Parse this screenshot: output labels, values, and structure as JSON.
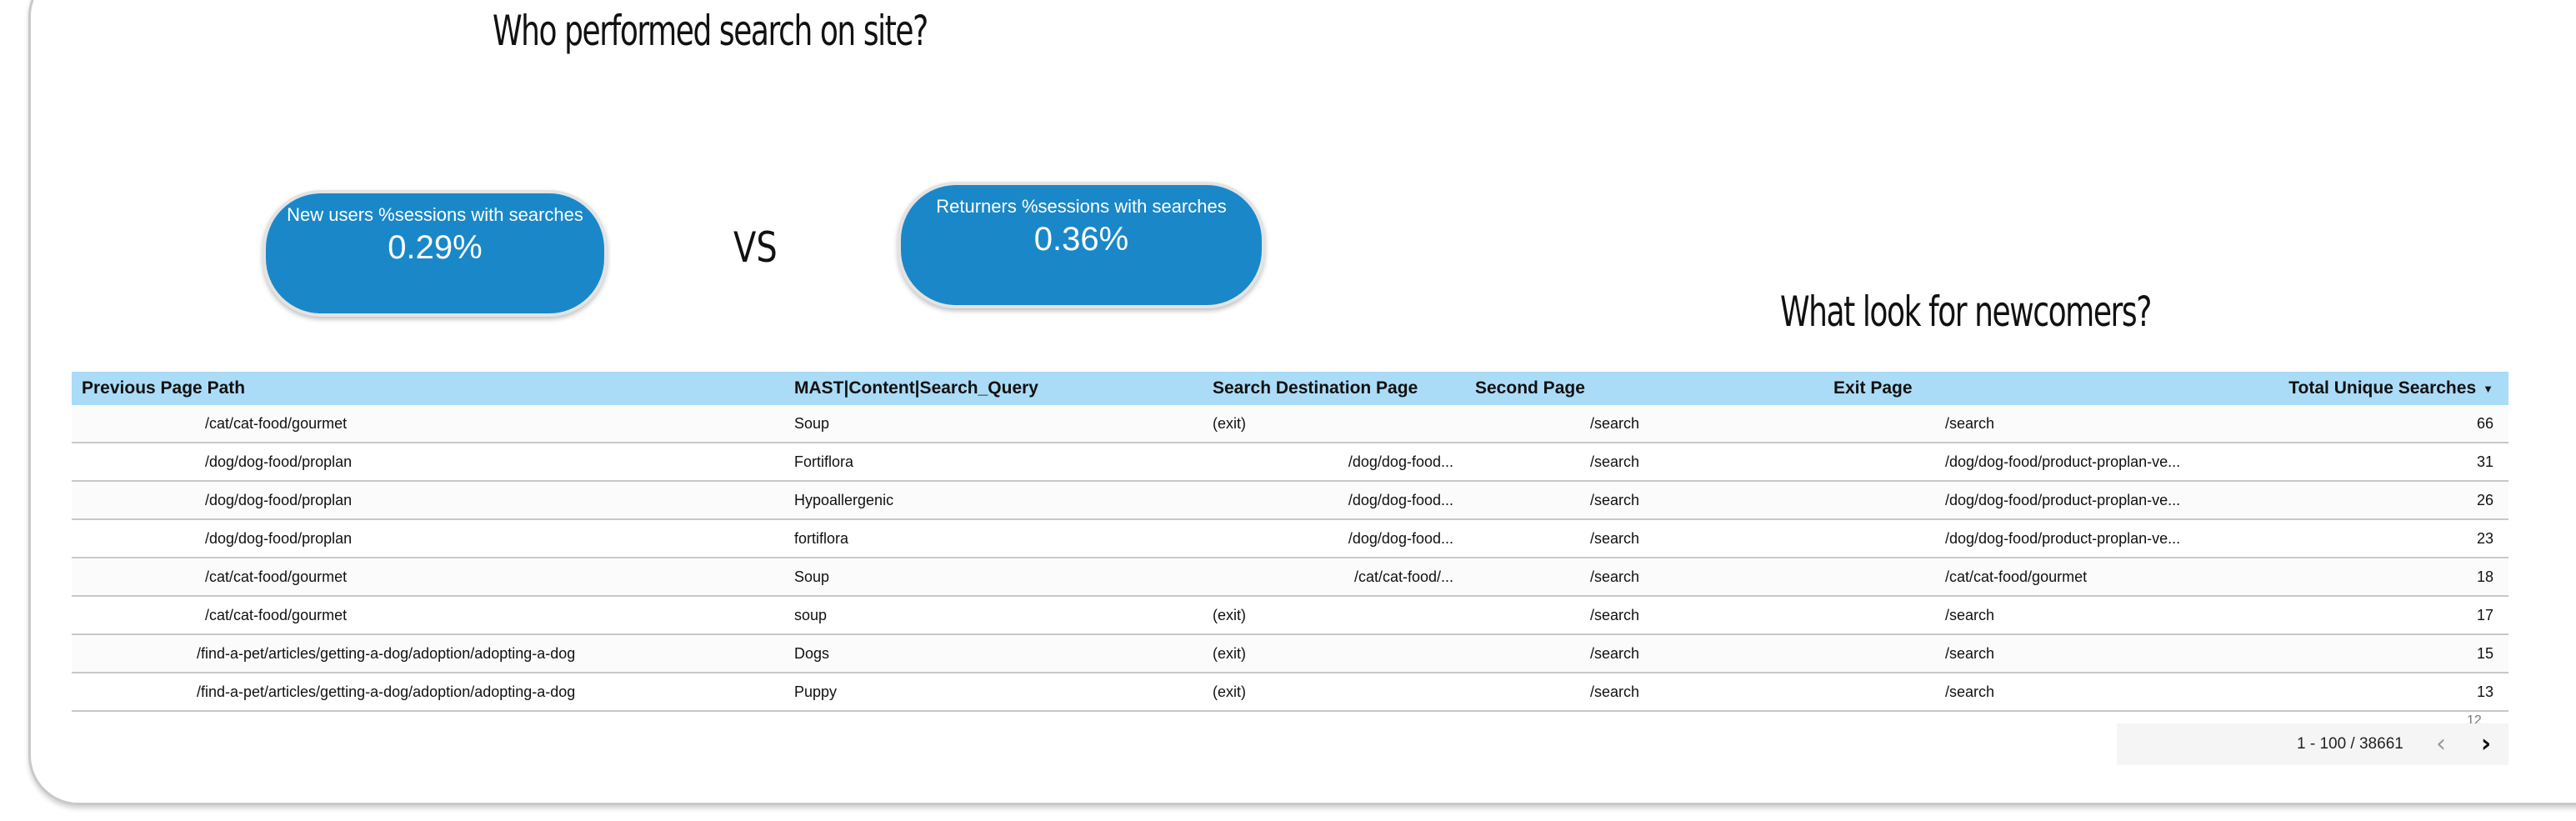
{
  "headings": {
    "who": "Who performed search on site?",
    "newcomers": "What look for newcomers?"
  },
  "vs_label": "VS",
  "kpis": {
    "new_users": {
      "label": "New users %sessions with searches",
      "value": "0.29%"
    },
    "returners": {
      "label": "Returners %sessions with searches",
      "value": "0.36%"
    }
  },
  "table": {
    "columns": [
      "Previous Page Path",
      "MAST|Content|Search_Query",
      "Search Destination Page",
      "Second Page",
      "Exit Page",
      "Total Unique Searches"
    ],
    "sort_icon": "sort-desc-icon",
    "rows": [
      {
        "prev": "/cat/cat-food/gourmet",
        "query": "Soup",
        "dest": "(exit)",
        "second": "/search",
        "exit": "/search",
        "total": "66"
      },
      {
        "prev": "/dog/dog-food/proplan",
        "query": "Fortiflora",
        "dest": "/dog/dog-food...",
        "second": "/search",
        "exit": "/dog/dog-food/product-proplan-ve...",
        "total": "31"
      },
      {
        "prev": "/dog/dog-food/proplan",
        "query": "Hypoallergenic",
        "dest": "/dog/dog-food...",
        "second": "/search",
        "exit": "/dog/dog-food/product-proplan-ve...",
        "total": "26"
      },
      {
        "prev": "/dog/dog-food/proplan",
        "query": "fortiflora",
        "dest": "/dog/dog-food...",
        "second": "/search",
        "exit": "/dog/dog-food/product-proplan-ve...",
        "total": "23"
      },
      {
        "prev": "/cat/cat-food/gourmet",
        "query": "Soup",
        "dest": "/cat/cat-food/...",
        "second": "/search",
        "exit": "/cat/cat-food/gourmet",
        "total": "18"
      },
      {
        "prev": "/cat/cat-food/gourmet",
        "query": "soup",
        "dest": "(exit)",
        "second": "/search",
        "exit": "/search",
        "total": "17"
      },
      {
        "prev": "/find-a-pet/articles/getting-a-dog/adoption/adopting-a-dog",
        "query": "Dogs",
        "dest": "(exit)",
        "second": "/search",
        "exit": "/search",
        "total": "15"
      },
      {
        "prev": "/find-a-pet/articles/getting-a-dog/adoption/adopting-a-dog",
        "query": "Puppy",
        "dest": "(exit)",
        "second": "/search",
        "exit": "/search",
        "total": "13"
      }
    ],
    "overflow_hint": "12"
  },
  "pagination": {
    "range": "1 - 100 / 38661",
    "prev_icon": "chevron-left-icon",
    "next_icon": "chevron-right-icon"
  }
}
